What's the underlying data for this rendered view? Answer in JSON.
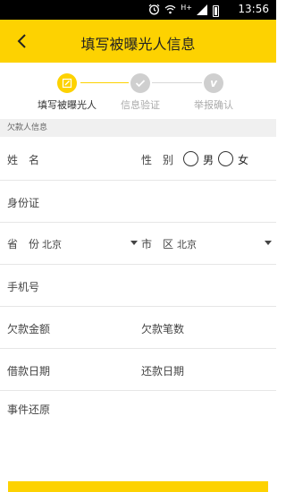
{
  "status_bar": {
    "network": "H+",
    "time": "13:56",
    "icons": [
      "alarm-icon",
      "wifi-icon",
      "signal-icon",
      "battery-icon"
    ]
  },
  "header": {
    "title": "填写被曝光人信息"
  },
  "steps": [
    {
      "label": "填写被曝光人",
      "state": "active",
      "icon": "edit-icon"
    },
    {
      "label": "信息验证",
      "state": "inactive",
      "icon": "check-icon"
    },
    {
      "label": "举报确认",
      "state": "inactive",
      "icon": "v-icon"
    }
  ],
  "section": {
    "title": "欠款人信息"
  },
  "form": {
    "name_label": "姓　名",
    "gender_label": "性　别",
    "gender_options": [
      "男",
      "女"
    ],
    "id_label": "身份证",
    "province_label": "省　份",
    "province_value": "北京",
    "city_label": "市　区",
    "city_value": "北京",
    "phone_label": "手机号",
    "amount_label": "欠款金额",
    "count_label": "欠款笔数",
    "borrow_date_label": "借款日期",
    "repay_date_label": "还款日期",
    "description_label": "事件还原"
  },
  "colors": {
    "accent": "#FDD201",
    "inactive_step": "#cfcfcf",
    "section_bg": "#f0f0f0"
  }
}
